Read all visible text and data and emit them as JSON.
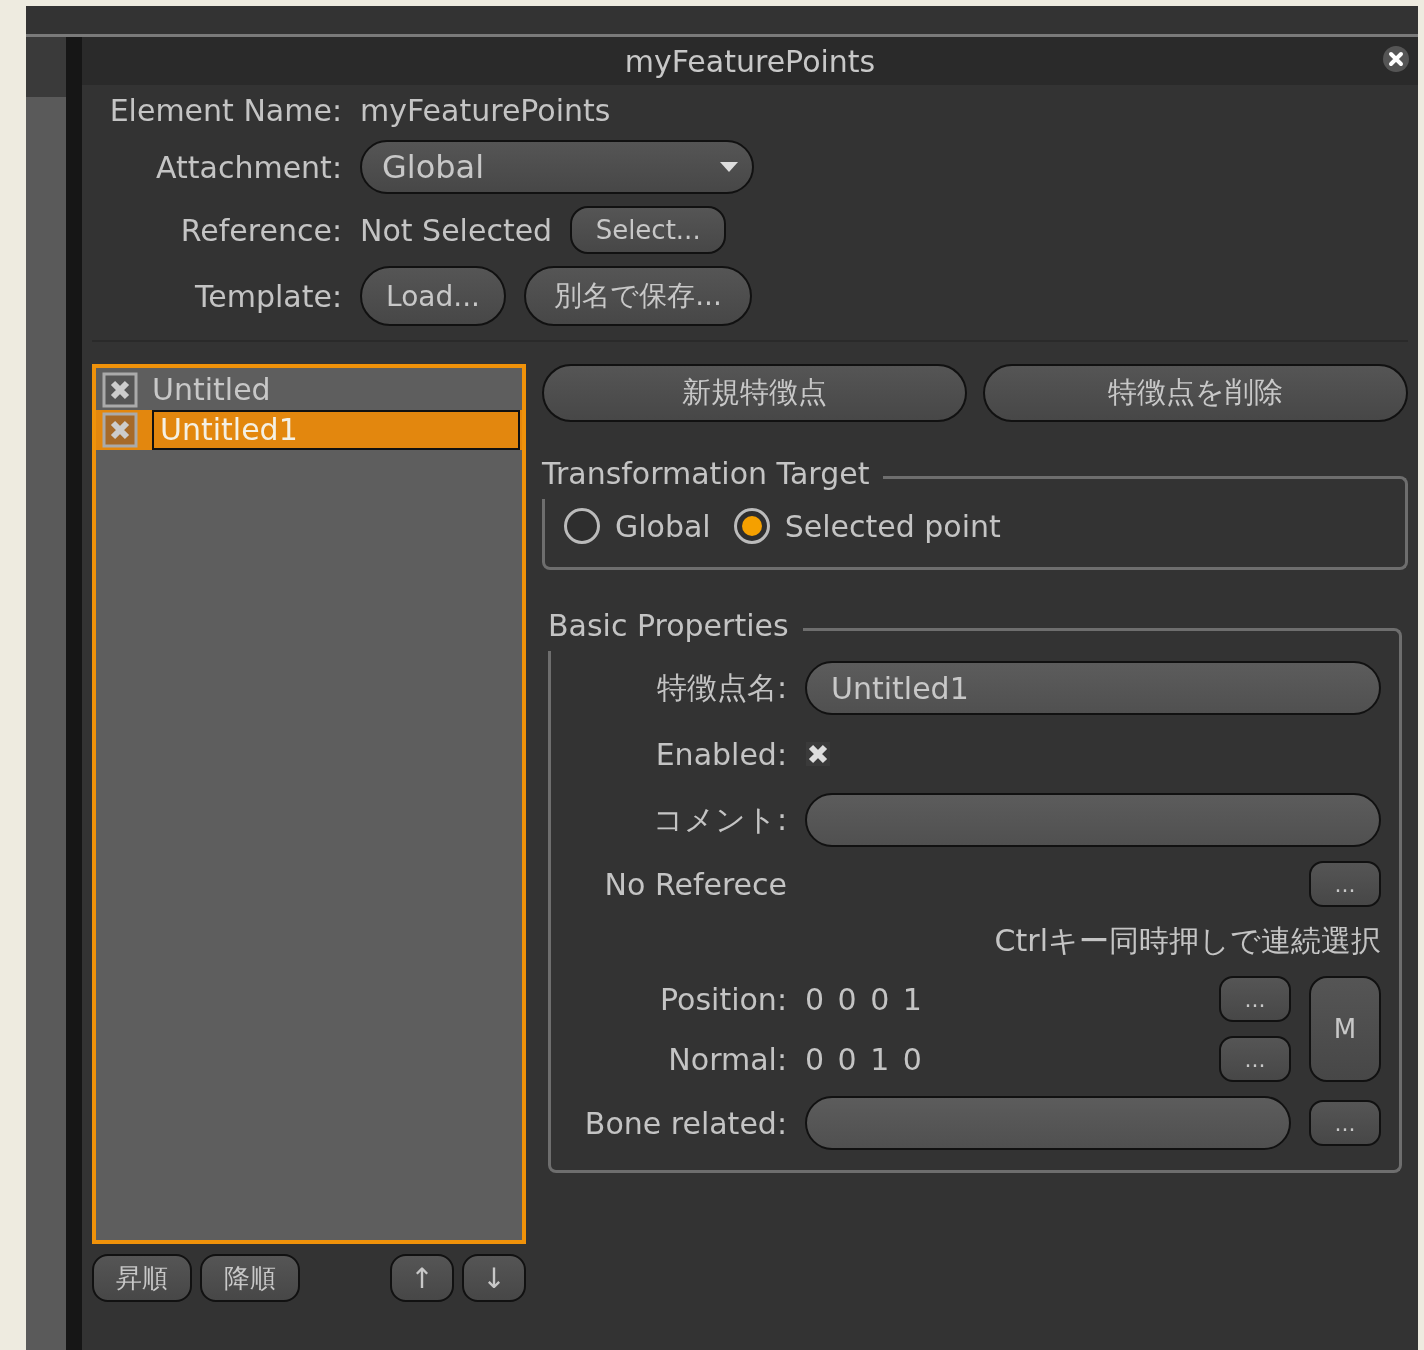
{
  "window": {
    "title": "myFeaturePoints"
  },
  "element_name": {
    "label": "Element Name:",
    "value": "myFeaturePoints"
  },
  "attachment": {
    "label": "Attachment:",
    "value": "Global"
  },
  "reference": {
    "label": "Reference:",
    "value": "Not Selected",
    "button": "Select..."
  },
  "template": {
    "label": "Template:",
    "buttons": [
      "Load...",
      "別名で保存..."
    ]
  },
  "feature_points": [
    {
      "name": "Untitled",
      "checked": true,
      "selected": false
    },
    {
      "name": "Untitled1",
      "checked": true,
      "selected": true
    }
  ],
  "list_buttons": [
    "昇順",
    "降順",
    "↑",
    "↓"
  ],
  "point_buttons": [
    "新規特徴点",
    "特徴点を削除"
  ],
  "transformation_target": {
    "title": "Transformation Target",
    "options": [
      {
        "label": "Global",
        "selected": false
      },
      {
        "label": "Selected point",
        "selected": true
      }
    ]
  },
  "basic_properties": {
    "title": "Basic Properties",
    "name": {
      "label": "特徴点名:",
      "value": "Untitled1"
    },
    "enabled": {
      "label": "Enabled:",
      "checked": true
    },
    "comment": {
      "label": "コメント:"
    },
    "reference": {
      "label": "No Referece",
      "button": "..."
    },
    "hint": "Ctrlキー同時押しで連続選択",
    "position": {
      "label": "Position:",
      "value": "0 0 0 1",
      "button": "..."
    },
    "normal": {
      "label": "Normal:",
      "value": "0 0 1 0",
      "button": "..."
    },
    "m_button": "M",
    "bone_related": {
      "label": "Bone related:",
      "button": "..."
    }
  }
}
